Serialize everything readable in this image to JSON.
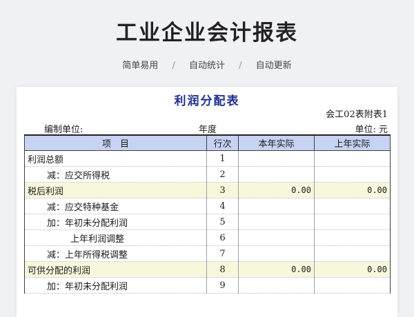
{
  "header": {
    "title": "工业企业会计报表",
    "features": [
      "简单易用",
      "自动统计",
      "自动更新"
    ],
    "separator": "/"
  },
  "report": {
    "title": "利润分配表",
    "form_no": "会工02表附表1",
    "unit_label": "编制单位:",
    "period_label": "年度",
    "currency_label": "单位: 元",
    "columns": [
      "项　目",
      "行次",
      "本年实际",
      "上年实际"
    ],
    "rows": [
      {
        "item": "利润总额",
        "line": "1",
        "current": "",
        "previous": "",
        "indent": 0,
        "highlight": false
      },
      {
        "item": "减：应交所得税",
        "line": "2",
        "current": "",
        "previous": "",
        "indent": 1,
        "highlight": false
      },
      {
        "item": "税后利润",
        "line": "3",
        "current": "0.00",
        "previous": "0.00",
        "indent": 0,
        "highlight": true
      },
      {
        "item": "减：应交特种基金",
        "line": "4",
        "current": "",
        "previous": "",
        "indent": 1,
        "highlight": false
      },
      {
        "item": "加：年初未分配利润",
        "line": "5",
        "current": "",
        "previous": "",
        "indent": 1,
        "highlight": false
      },
      {
        "item": "上年利润调整",
        "line": "6",
        "current": "",
        "previous": "",
        "indent": 2,
        "highlight": false
      },
      {
        "item": "减：上年所得税调整",
        "line": "7",
        "current": "",
        "previous": "",
        "indent": 1,
        "highlight": false
      },
      {
        "item": "可供分配的利润",
        "line": "8",
        "current": "0.00",
        "previous": "0.00",
        "indent": 0,
        "highlight": true
      },
      {
        "item": "加：年初未分配利润",
        "line": "9",
        "current": "",
        "previous": "",
        "indent": 1,
        "highlight": false
      }
    ]
  }
}
